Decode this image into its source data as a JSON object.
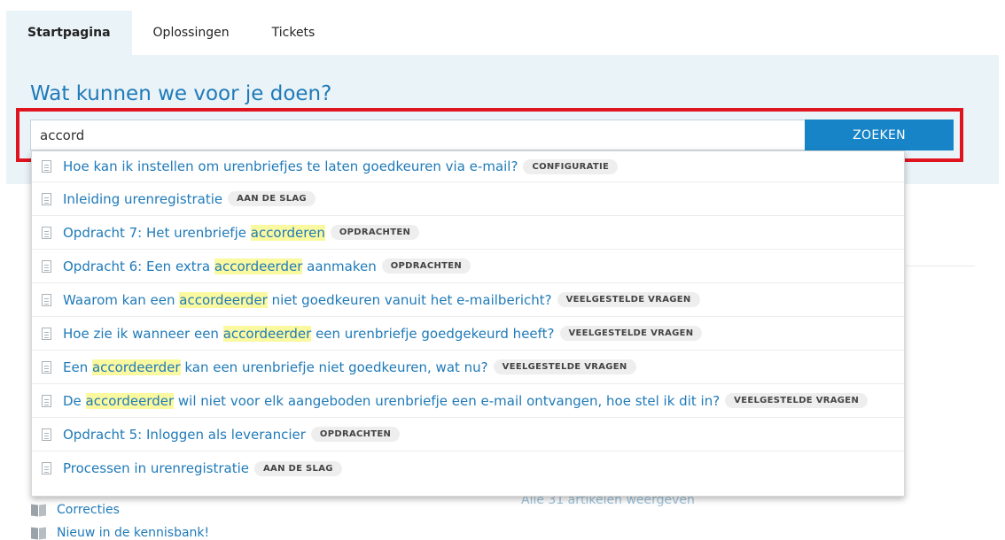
{
  "tabs": [
    {
      "label": "Startpagina",
      "active": true
    },
    {
      "label": "Oplossingen",
      "active": false
    },
    {
      "label": "Tickets",
      "active": false
    }
  ],
  "hero": {
    "title": "Wat kunnen we voor je doen?",
    "search_value": "accord",
    "search_button": "ZOEKEN"
  },
  "results": [
    {
      "pre": "Hoe kan ik instellen om urenbriefjes te laten goedkeuren via e-mail?",
      "hl": "",
      "post": "",
      "tag": "CONFIGURATIE"
    },
    {
      "pre": "Inleiding urenregistratie",
      "hl": "",
      "post": "",
      "tag": "AAN DE SLAG"
    },
    {
      "pre": "Opdracht 7: Het urenbriefje ",
      "hl": "accorderen",
      "post": "",
      "tag": "OPDRACHTEN"
    },
    {
      "pre": "Opdracht 6: Een extra ",
      "hl": "accordeerder",
      "post": " aanmaken",
      "tag": "OPDRACHTEN"
    },
    {
      "pre": "Waarom kan een ",
      "hl": "accordeerder",
      "post": " niet goedkeuren vanuit het e-mailbericht?",
      "tag": "VEELGESTELDE VRAGEN"
    },
    {
      "pre": "Hoe zie ik wanneer een ",
      "hl": "accordeerder",
      "post": " een urenbriefje goedgekeurd heeft?",
      "tag": "VEELGESTELDE VRAGEN"
    },
    {
      "pre": "Een ",
      "hl": "accordeerder",
      "post": " kan een urenbriefje niet goedkeuren, wat nu?",
      "tag": "VEELGESTELDE VRAGEN"
    },
    {
      "pre": "De ",
      "hl": "accordeerder",
      "post": " wil niet voor elk aangeboden urenbriefje een e-mail ontvangen, hoe stel ik dit in?",
      "tag": "VEELGESTELDE VRAGEN"
    },
    {
      "pre": "Opdracht 5: Inloggen als leverancier",
      "hl": "",
      "post": "",
      "tag": "OPDRACHTEN"
    },
    {
      "pre": "Processen in urenregistratie",
      "hl": "",
      "post": "",
      "tag": "AAN DE SLAG"
    }
  ],
  "background": {
    "items": [
      "Correcties",
      "Nieuw in de kennisbank!"
    ],
    "all_articles": "Alle 31 artikelen weergeven"
  },
  "colors": {
    "accent": "#1784c8",
    "link": "#1f7ab8",
    "highlight_box": "#e0141f",
    "hero_bg": "#eaf3f8"
  }
}
